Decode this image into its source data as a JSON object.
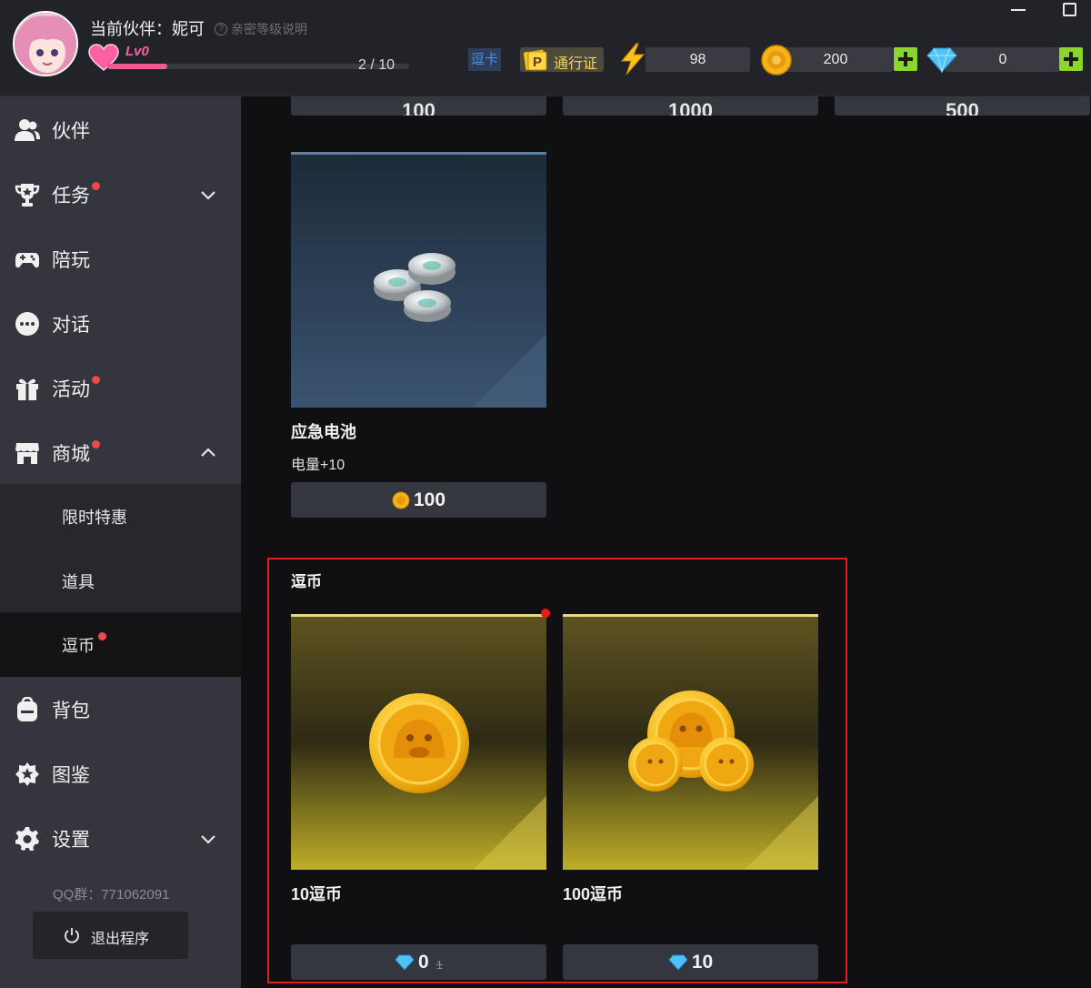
{
  "header": {
    "partner_label": "当前伙伴：妮可",
    "help_text": "亲密等级说明",
    "level": "Lv0",
    "intimacy_progress": "2 / 10",
    "intimacy_fraction": 0.2,
    "doucard_label": "逗卡",
    "pass_label": "通行证",
    "energy_value": "98",
    "coin_value": "200",
    "diamond_value": "0"
  },
  "sidebar": {
    "items": [
      {
        "label": "伙伴",
        "icon": "user-group-icon"
      },
      {
        "label": "任务",
        "icon": "trophy-icon",
        "badge": true
      },
      {
        "label": "陪玩",
        "icon": "gamepad-icon"
      },
      {
        "label": "对话",
        "icon": "chat-icon"
      },
      {
        "label": "活动",
        "icon": "gift-icon",
        "badge": true
      },
      {
        "label": "商城",
        "icon": "store-icon",
        "badge": true
      },
      {
        "label": "背包",
        "icon": "backpack-icon"
      },
      {
        "label": "图鉴",
        "icon": "star-badge-icon"
      },
      {
        "label": "设置",
        "icon": "gear-icon"
      }
    ],
    "shop_sub": [
      "限时特惠",
      "道具",
      "逗币"
    ],
    "qq_group": "QQ群：771062091",
    "exit_label": "退出程序"
  },
  "main": {
    "top_partial_prices": [
      "100",
      "1000",
      "500"
    ],
    "battery": {
      "title": "应急电池",
      "desc": "电量+10",
      "price": "100"
    },
    "coins_section": {
      "title": "逗币",
      "items": [
        {
          "title": "10逗币",
          "price": "0",
          "original_price": "1"
        },
        {
          "title": "100逗币",
          "price": "10"
        }
      ]
    }
  },
  "colors": {
    "accent_green": "#8cd42e",
    "highlight_red": "#e02020",
    "pink": "#f05a94",
    "gold": "#f5c21e"
  }
}
